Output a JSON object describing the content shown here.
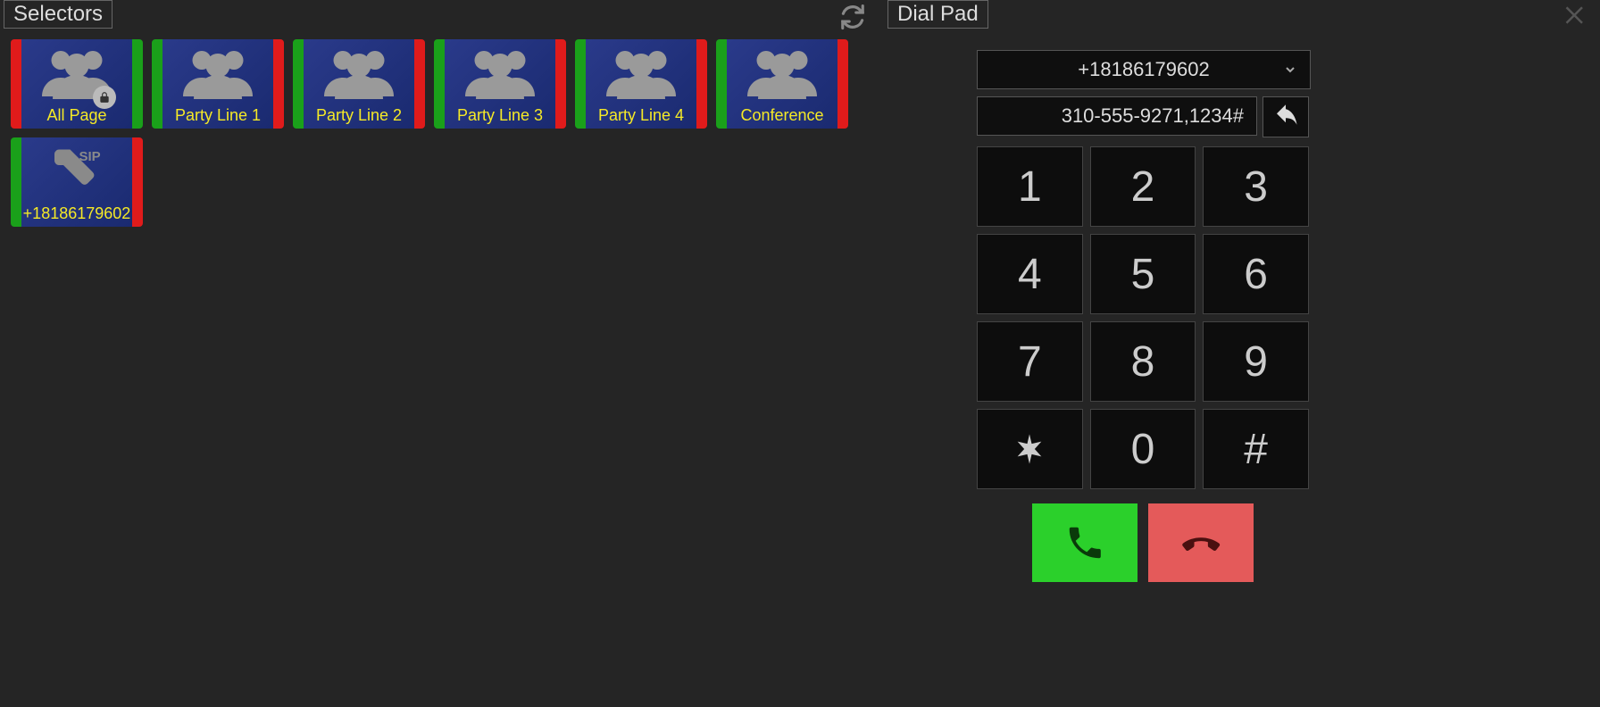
{
  "selectors_panel": {
    "title": "Selectors",
    "items": [
      {
        "label": "All Page",
        "left_band": "#e01b1b",
        "right_band": "#1aa01a",
        "icon": "group",
        "lock": true
      },
      {
        "label": "Party Line 1",
        "left_band": "#1aa01a",
        "right_band": "#e01b1b",
        "icon": "group",
        "lock": false
      },
      {
        "label": "Party Line 2",
        "left_band": "#1aa01a",
        "right_band": "#e01b1b",
        "icon": "group",
        "lock": false
      },
      {
        "label": "Party Line 3",
        "left_band": "#1aa01a",
        "right_band": "#e01b1b",
        "icon": "group",
        "lock": false
      },
      {
        "label": "Party Line 4",
        "left_band": "#1aa01a",
        "right_band": "#e01b1b",
        "icon": "group",
        "lock": false
      },
      {
        "label": "Conference",
        "left_band": "#1aa01a",
        "right_band": "#e01b1b",
        "icon": "group",
        "lock": false
      },
      {
        "label": "+18186179602",
        "left_band": "#1aa01a",
        "right_band": "#e01b1b",
        "icon": "sip",
        "lock": false
      }
    ]
  },
  "dialpad_panel": {
    "title": "Dial Pad",
    "selected_line": "+18186179602",
    "number_entry": "310-555-9271,1234#",
    "keys": [
      "1",
      "2",
      "3",
      "4",
      "5",
      "6",
      "7",
      "8",
      "9",
      "*",
      "0",
      "#"
    ]
  }
}
